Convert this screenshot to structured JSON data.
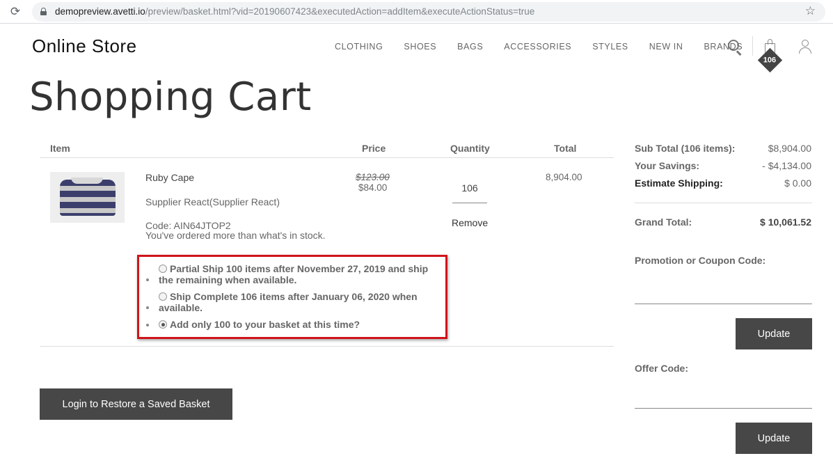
{
  "browser": {
    "reload_glyph": "⟳",
    "url_host": "demopreview.avetti.io",
    "url_path": "/preview/basket.html?vid=20190607423&executedAction=addItem&executeActionStatus=true",
    "star_glyph": "☆"
  },
  "header": {
    "brand": "Online Store",
    "nav": [
      "CLOTHING",
      "SHOES",
      "BAGS",
      "ACCESSORIES",
      "STYLES",
      "NEW IN",
      "BRANDS"
    ],
    "cart_count": "106"
  },
  "page_title": "Shopping Cart",
  "table": {
    "headers": {
      "item": "Item",
      "price": "Price",
      "quantity": "Quantity",
      "total": "Total"
    }
  },
  "cart_item": {
    "name": "Ruby Cape",
    "supplier": "Supplier React(Supplier React)",
    "code": "Code: AIN64JTOP2",
    "stock_note": "You've ordered more than what's in stock.",
    "price_original": "$123.00",
    "price_sale": "$84.00",
    "quantity": "106",
    "remove_label": "Remove",
    "line_total": "8,904.00"
  },
  "ship_options": [
    {
      "label": "Partial Ship 100 items after November 27, 2019 and ship the remaining when available.",
      "checked": false
    },
    {
      "label": "Ship Complete 106 items after January 06, 2020 when available.",
      "checked": false
    },
    {
      "label": "Add only 100 to your basket at this time?",
      "checked": true
    }
  ],
  "login_restore_label": "Login to Restore a Saved Basket",
  "summary": {
    "subtotal_label": "Sub Total (106 items):",
    "subtotal_value": "$8,904.00",
    "savings_label": "Your Savings:",
    "savings_value": "- $4,134.00",
    "shipping_label": "Estimate Shipping:",
    "shipping_value": "$ 0.00",
    "grand_total_label": "Grand Total:",
    "grand_total_value": "$ 10,061.52",
    "promo_label": "Promotion or Coupon Code:",
    "promo_button": "Update",
    "offer_label": "Offer Code:",
    "offer_button": "Update"
  },
  "colors": {
    "accent_dark": "#474747",
    "highlight_border": "#d0141b"
  }
}
